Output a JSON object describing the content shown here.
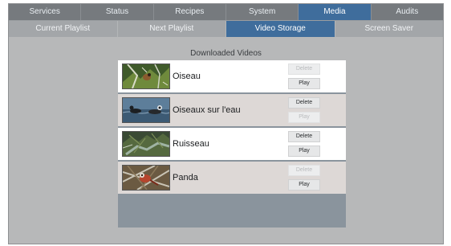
{
  "top_tabs": [
    {
      "label": "Services",
      "active": false
    },
    {
      "label": "Status",
      "active": false
    },
    {
      "label": "Recipes",
      "active": false
    },
    {
      "label": "System",
      "active": false
    },
    {
      "label": "Media",
      "active": true
    },
    {
      "label": "Audits",
      "active": false
    }
  ],
  "sub_tabs": [
    {
      "label": "Current Playlist",
      "active": false
    },
    {
      "label": "Next Playlist",
      "active": false
    },
    {
      "label": "Video Storage",
      "active": true
    },
    {
      "label": "Screen Saver",
      "active": false
    }
  ],
  "section_title": "Downloaded Videos",
  "videos": [
    {
      "title": "Oiseau",
      "delete_label": "Delete",
      "play_label": "Play",
      "delete_enabled": false,
      "play_enabled": true,
      "thumbnail_icon": "bird-thumbnail-icon"
    },
    {
      "title": "Oiseaux sur l'eau",
      "delete_label": "Delete",
      "play_label": "Play",
      "delete_enabled": true,
      "play_enabled": false,
      "thumbnail_icon": "ducks-thumbnail-icon"
    },
    {
      "title": "Ruisseau",
      "delete_label": "Delete",
      "play_label": "Play",
      "delete_enabled": true,
      "play_enabled": true,
      "thumbnail_icon": "stream-thumbnail-icon"
    },
    {
      "title": "Panda",
      "delete_label": "Delete",
      "play_label": "Play",
      "delete_enabled": false,
      "play_enabled": true,
      "thumbnail_icon": "panda-thumbnail-icon"
    }
  ],
  "colors": {
    "active_tab": "#3f6d9c",
    "top_bar": "#767a7e",
    "sub_bar": "#a3a6a9",
    "background": "#b7b8b9",
    "list_panel": "#8a949d"
  }
}
